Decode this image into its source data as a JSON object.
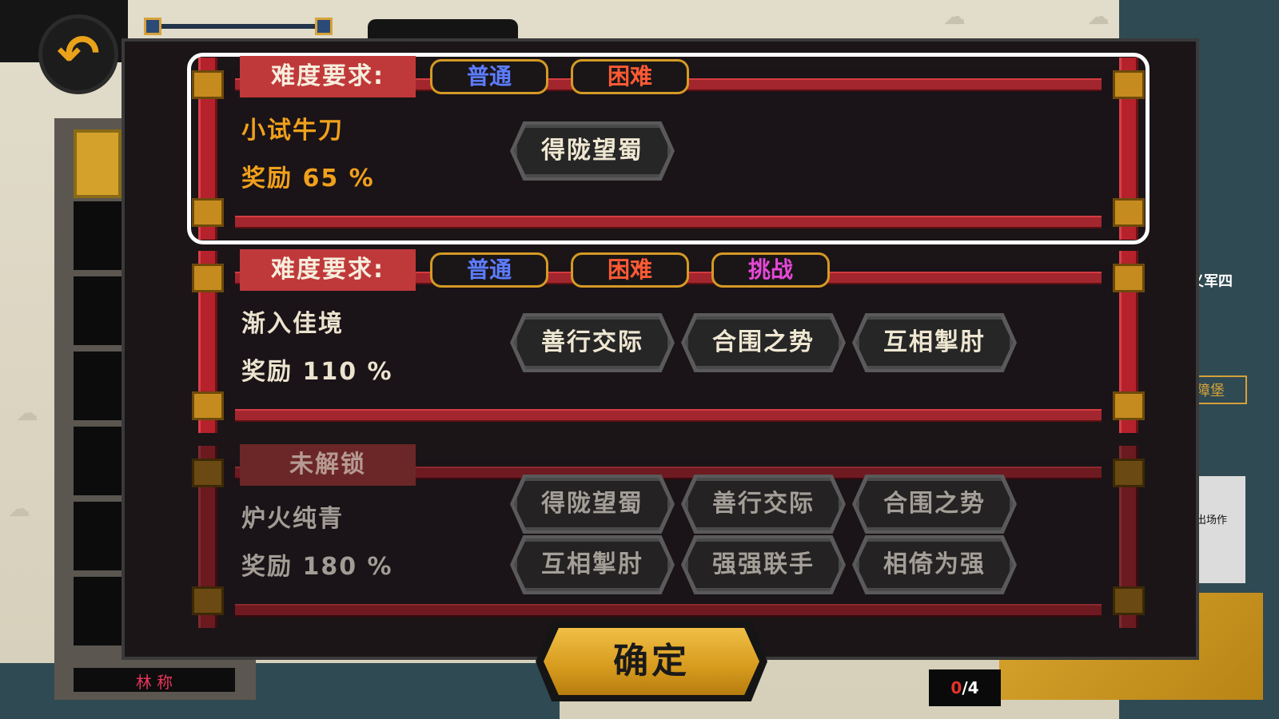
{
  "background": {
    "left_panel_name": "林 称",
    "right_card_title": "义军四",
    "right_button_label": "障堡",
    "right_photo_caption": "出场作"
  },
  "counter": {
    "current": "0",
    "total": "/4"
  },
  "difficulty_label": "难度要求:",
  "locked_label": "未解锁",
  "difficulties": {
    "normal": "普通",
    "hard": "困难",
    "challenge": "挑战"
  },
  "rows": [
    {
      "title": "小试牛刀",
      "reward": "奖励  65 %",
      "selected": true,
      "skills": [
        "得陇望蜀"
      ]
    },
    {
      "title": "渐入佳境",
      "reward": "奖励  110 %",
      "selected": false,
      "skills": [
        "善行交际",
        "合围之势",
        "互相掣肘"
      ]
    },
    {
      "title": "炉火纯青",
      "reward": "奖励  180 %",
      "locked": true,
      "skills": [
        "得陇望蜀",
        "善行交际",
        "合围之势",
        "互相掣肘",
        "强强联手",
        "相倚为强"
      ]
    }
  ],
  "confirm_label": "确定",
  "colors": {
    "normal": "#5d7cff",
    "hard": "#ff5a34",
    "challenge": "#e648d8",
    "selected_text": "#f0a01c",
    "gold": "#d69a1d"
  }
}
